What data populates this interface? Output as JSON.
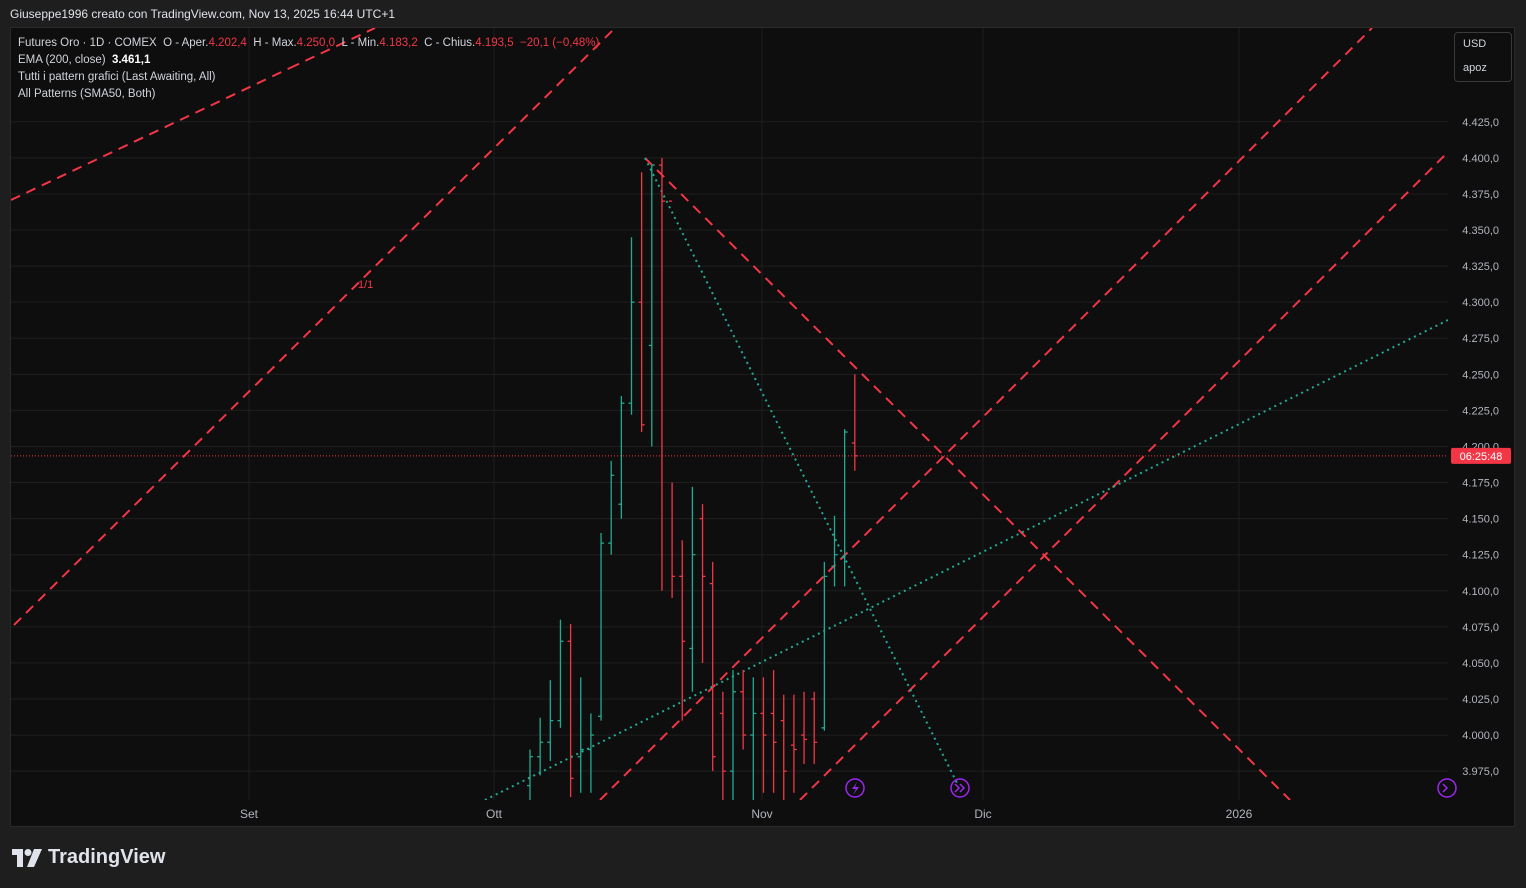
{
  "header": {
    "title": "Giuseppe1996 creato con TradingView.com, Nov 13, 2025 16:44 UTC+1"
  },
  "legend": {
    "symbol": "Futures Oro · 1D · COMEX",
    "open_label": "O - Aper.",
    "open_value": "4.202,4",
    "high_label": "H - Max.",
    "high_value": "4.250,0",
    "low_label": "L - Min.",
    "low_value": "4.183,2",
    "close_label": "C - Chius.",
    "close_value": "4.193,5",
    "change": "−20,1 (−0,48%)",
    "ema_label": "EMA (200, close)",
    "ema_value": "3.461,1",
    "pattern1": "Tutti i pattern grafici (Last Awaiting, All)",
    "pattern2": "All Patterns (SMA50, Both)"
  },
  "currency": {
    "unit": "USD",
    "scale": "apoz"
  },
  "countdown": "06:25:48",
  "pattern_label": "1/1",
  "brand": "TradingView",
  "colors": {
    "up": "#22ab94",
    "down": "#f23645",
    "pattern_line": "#f23645",
    "trend_line": "#22ab94",
    "event_icon": "#9c27f0"
  },
  "chart_data": {
    "type": "ohlc",
    "ylim": [
      3955,
      4490
    ],
    "y_ticks": [
      "3.975,0",
      "4.000,0",
      "4.025,0",
      "4.050,0",
      "4.075,0",
      "4.100,0",
      "4.125,0",
      "4.150,0",
      "4.175,0",
      "4.200,0",
      "4.225,0",
      "4.250,0",
      "4.275,0",
      "4.300,0",
      "4.325,0",
      "4.350,0",
      "4.375,0",
      "4.400,0",
      "4.425,0"
    ],
    "x_labels": [
      "Set",
      "Ott",
      "Nov",
      "Dic",
      "2026"
    ],
    "last_price": 4193.5,
    "bars": [
      {
        "d": "Oct 01",
        "o": 3965,
        "h": 3990,
        "l": 3955,
        "c": 3985
      },
      {
        "d": "Oct 02",
        "o": 3985,
        "h": 4012,
        "l": 3972,
        "c": 3995
      },
      {
        "d": "Oct 03",
        "o": 3995,
        "h": 4038,
        "l": 3982,
        "c": 4010
      },
      {
        "d": "Oct 06",
        "o": 4010,
        "h": 4080,
        "l": 4005,
        "c": 4065
      },
      {
        "d": "Oct 07",
        "o": 4065,
        "h": 4077,
        "l": 3957,
        "c": 3970
      },
      {
        "d": "Oct 08",
        "o": 3985,
        "h": 4040,
        "l": 3960,
        "c": 3990
      },
      {
        "d": "Oct 09",
        "o": 3990,
        "h": 4015,
        "l": 3960,
        "c": 4000
      },
      {
        "d": "Oct 10",
        "o": 4013,
        "h": 4140,
        "l": 4010,
        "c": 4133
      },
      {
        "d": "Oct 13",
        "o": 4133,
        "h": 4190,
        "l": 4125,
        "c": 4180
      },
      {
        "d": "Oct 14",
        "o": 4160,
        "h": 4235,
        "l": 4150,
        "c": 4230
      },
      {
        "d": "Oct 15",
        "o": 4230,
        "h": 4345,
        "l": 4222,
        "c": 4300
      },
      {
        "d": "Oct 16",
        "o": 4300,
        "h": 4390,
        "l": 4210,
        "c": 4215
      },
      {
        "d": "Oct 17",
        "o": 4270,
        "h": 4395,
        "l": 4200,
        "c": 4395
      },
      {
        "d": "Oct 20",
        "o": 4395,
        "h": 4400,
        "l": 4100,
        "c": 4370
      },
      {
        "d": "Oct 21",
        "o": 4370,
        "h": 4175,
        "l": 4095,
        "c": 4110
      },
      {
        "d": "Oct 22",
        "o": 4110,
        "h": 4135,
        "l": 4010,
        "c": 4065
      },
      {
        "d": "Oct 23",
        "o": 4060,
        "h": 4172,
        "l": 4030,
        "c": 4125
      },
      {
        "d": "Oct 24",
        "o": 4150,
        "h": 4160,
        "l": 4050,
        "c": 4110
      },
      {
        "d": "Oct 27",
        "o": 4105,
        "h": 4120,
        "l": 3975,
        "c": 3985
      },
      {
        "d": "Oct 28",
        "o": 4015,
        "h": 4030,
        "l": 3955,
        "c": 3975
      },
      {
        "d": "Oct 29",
        "o": 3975,
        "h": 4045,
        "l": 3955,
        "c": 4030
      },
      {
        "d": "Oct 30",
        "o": 4030,
        "h": 4045,
        "l": 3990,
        "c": 4000
      },
      {
        "d": "Oct 31",
        "o": 4000,
        "h": 4040,
        "l": 3955,
        "c": 4015
      },
      {
        "d": "Nov 03",
        "o": 4015,
        "h": 4040,
        "l": 3960,
        "c": 4000
      },
      {
        "d": "Nov 04",
        "o": 4015,
        "h": 4045,
        "l": 3960,
        "c": 3995
      },
      {
        "d": "Nov 05",
        "o": 4010,
        "h": 4028,
        "l": 3955,
        "c": 3975
      },
      {
        "d": "Nov 06",
        "o": 3993,
        "h": 4028,
        "l": 3960,
        "c": 3990
      },
      {
        "d": "Nov 07",
        "o": 4000,
        "h": 4030,
        "l": 3980,
        "c": 3997
      },
      {
        "d": "Nov 10",
        "o": 4025,
        "h": 4030,
        "l": 3980,
        "c": 3995
      },
      {
        "d": "Nov 11",
        "o": 4005,
        "h": 4120,
        "l": 4003,
        "c": 4110
      },
      {
        "d": "Nov 12",
        "o": 4117,
        "h": 4152,
        "l": 4103,
        "c": 4125
      },
      {
        "d": "Nov 13",
        "o": 4123,
        "h": 4212,
        "l": 4103,
        "c": 4210
      },
      {
        "d": "Nov 14",
        "o": 4202.4,
        "h": 4250,
        "l": 4183.2,
        "c": 4193.5
      }
    ]
  }
}
